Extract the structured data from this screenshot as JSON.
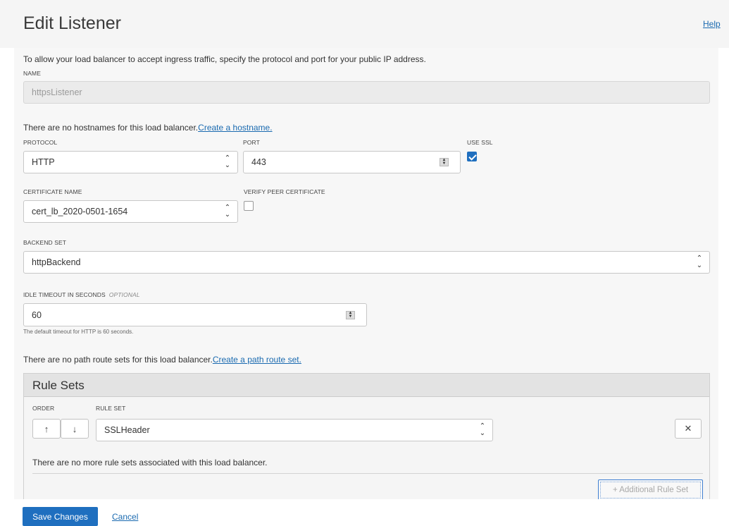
{
  "header": {
    "title": "Edit Listener",
    "help": "Help"
  },
  "intro": "To allow your load balancer to accept ingress traffic, specify the protocol and port for your public IP address.",
  "name": {
    "label": "NAME",
    "value": "httpsListener"
  },
  "hostnames": {
    "text": "There are no hostnames for this load balancer.",
    "link": "Create a hostname."
  },
  "protocol": {
    "label": "PROTOCOL",
    "value": "HTTP"
  },
  "port": {
    "label": "PORT",
    "value": "443"
  },
  "use_ssl": {
    "label": "USE SSL",
    "checked": true
  },
  "certificate": {
    "label": "CERTIFICATE NAME",
    "value": "cert_lb_2020-0501-1654"
  },
  "verify_peer": {
    "label": "VERIFY PEER CERTIFICATE",
    "checked": false
  },
  "backend_set": {
    "label": "BACKEND SET",
    "value": "httpBackend"
  },
  "idle_timeout": {
    "label": "IDLE TIMEOUT IN SECONDS",
    "optional": "OPTIONAL",
    "value": "60",
    "help": "The default timeout for HTTP is 60 seconds."
  },
  "path_route": {
    "text": "There are no path route sets for this load balancer.",
    "link": "Create a path route set."
  },
  "rule_sets": {
    "title": "Rule Sets",
    "order_label": "ORDER",
    "rule_set_label": "RULE SET",
    "up_icon": "↑",
    "down_icon": "↓",
    "remove_icon": "✕",
    "selected": "SSLHeader",
    "empty_text": "There are no more rule sets associated with this load balancer.",
    "add_label": "+ Additional Rule Set"
  },
  "footer": {
    "save": "Save Changes",
    "cancel": "Cancel"
  },
  "colors": {
    "primary": "#1f6fbf",
    "link": "#1a6ab0"
  }
}
